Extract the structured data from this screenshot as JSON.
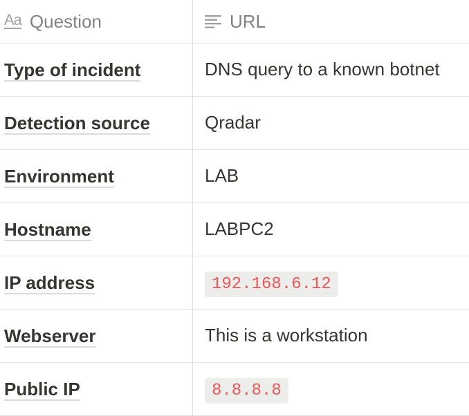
{
  "table": {
    "columns": {
      "question": {
        "label": "Question",
        "icon": "text-title-icon"
      },
      "url": {
        "label": "URL",
        "icon": "text-lines-icon"
      }
    },
    "rows": [
      {
        "question": "Type of incident",
        "url": "DNS query to a known botnet",
        "url_style": "plain"
      },
      {
        "question": "Detection source",
        "url": "Qradar",
        "url_style": "plain"
      },
      {
        "question": "Environment",
        "url": "LAB",
        "url_style": "plain"
      },
      {
        "question": "Hostname",
        "url": "LABPC2",
        "url_style": "plain"
      },
      {
        "question": "IP address",
        "url": "192.168.6.12",
        "url_style": "code"
      },
      {
        "question": "Webserver",
        "url": "This is a workstation",
        "url_style": "plain"
      },
      {
        "question": "Public IP",
        "url": "8.8.8.8",
        "url_style": "code"
      }
    ]
  },
  "colors": {
    "text": "#37352f",
    "muted": "#9b9a97",
    "border": "#e3e2e0",
    "code_text": "#eb5757",
    "code_bg": "#efeeec"
  }
}
